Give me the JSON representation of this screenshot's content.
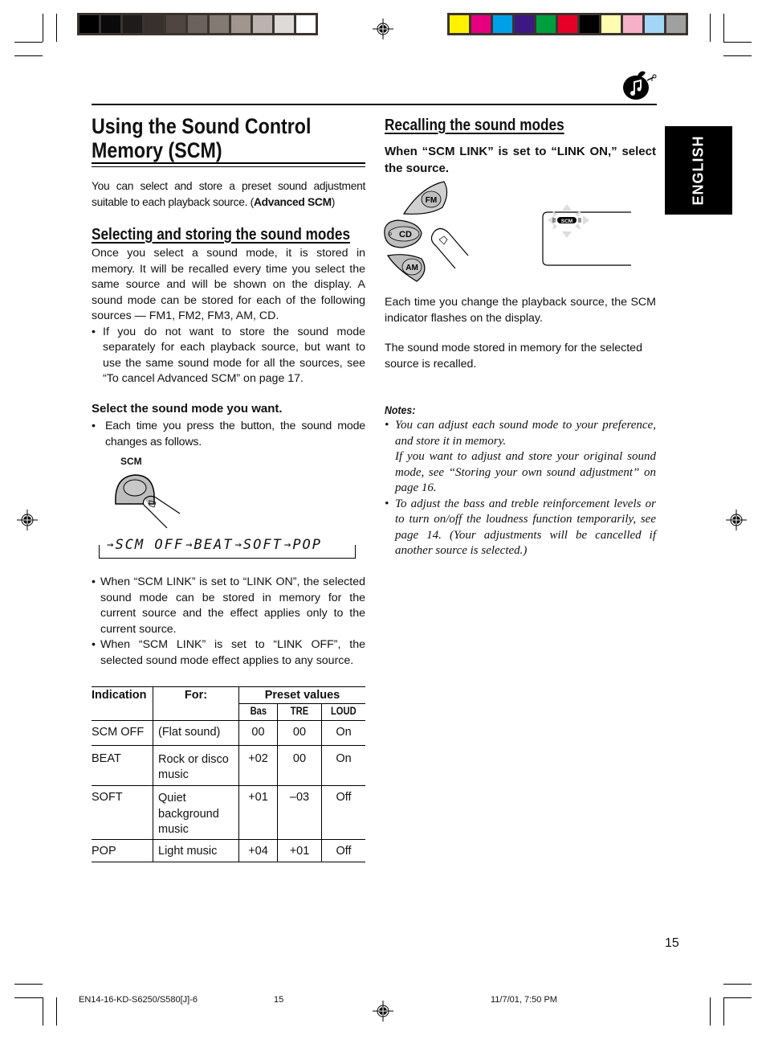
{
  "print_marks": {
    "grayscale_bar": [
      "#000000",
      "#0a0a0a",
      "#1e1b1a",
      "#38302d",
      "#4f4641",
      "#6b625d",
      "#847a74",
      "#a0958f",
      "#bcb2ae",
      "#dedad8",
      "#ffffff"
    ],
    "color_bar": [
      "#fff200",
      "#e6007e",
      "#00a0e9",
      "#3c1882",
      "#009e3f",
      "#e60027",
      "#000000",
      "#fffbb0",
      "#f6b0c8",
      "#a3d6f5",
      "#a0a0a0"
    ]
  },
  "sidebar": {
    "language_tab": "ENGLISH"
  },
  "header": {
    "icon": "music-note-bag-icon"
  },
  "left": {
    "title_line1": "Using the Sound Control",
    "title_line2": "Memory (SCM)",
    "intro_text": "You can select and store a preset sound adjustment suitable to each playback source. (",
    "intro_bold": "Advanced SCM",
    "intro_end": ")",
    "section_heading": "Selecting and storing the sound modes",
    "section_body": "Once you select a sound mode, it is stored in memory. It will be recalled every time you select the same source and will be shown on the display. A sound mode can be stored for each of the following sources — FM1, FM2, FM3, AM, CD.",
    "section_bullet": "If you do not want to store the sound mode separately for each playback source, but want to use the same sound mode for all the sources, see “To cancel Advanced SCM” on page 17.",
    "step_heading": "Select the sound mode you want.",
    "step_bullet": "Each time you press the button, the sound mode changes as follows.",
    "scm_button_label": "SCM",
    "mode_sequence": [
      "SCM OFF",
      "BEAT",
      "SOFT",
      "POP"
    ],
    "link_bullets": [
      "When “SCM LINK” is set to “LINK ON”, the selected sound mode can be stored in memory for the current source and the effect applies only to the current source.",
      "When “SCM LINK” is set to “LINK OFF”, the selected sound mode effect applies to any source."
    ]
  },
  "table": {
    "headers": {
      "indication": "Indication",
      "for": "For:",
      "preset": "Preset values",
      "bas": "Bas",
      "tre": "TRE",
      "loud": "LOUD"
    },
    "rows": [
      {
        "indication": "SCM OFF",
        "for": "(Flat sound)",
        "bas": "00",
        "tre": "00",
        "loud": "On"
      },
      {
        "indication": "BEAT",
        "for": "Rock or disco music",
        "bas": "+02",
        "tre": "00",
        "loud": "On"
      },
      {
        "indication": "SOFT",
        "for": "Quiet background music",
        "bas": "+01",
        "tre": "–03",
        "loud": "Off"
      },
      {
        "indication": "POP",
        "for": "Light music",
        "bas": "+04",
        "tre": "+01",
        "loud": "Off"
      }
    ]
  },
  "right": {
    "section_heading": "Recalling the sound modes",
    "step_heading": "When “SCM LINK” is set to “LINK ON,” select the source.",
    "source_buttons": [
      "FM",
      "CD",
      "AM"
    ],
    "display_indicator": "SCM",
    "body1": "Each time you change the playback source, the SCM indicator flashes on the display.",
    "body2": "The sound mode stored in memory for the selected source is recalled.",
    "notes_heading": "Notes:",
    "note1_a": "You can adjust each sound mode to your preference, and store it in memory.",
    "note1_b": "If you want to adjust and store your original sound mode, see “Storing your own sound adjustment” on page 16.",
    "note2": "To adjust the bass and treble reinforcement levels or to turn on/off the loudness function temporarily, see page 14. (Your adjustments will be cancelled if another source is selected.)"
  },
  "page_number": "15",
  "footer": {
    "file": "EN14-16-KD-S6250/S580[J]-6",
    "page": "15",
    "timestamp": "11/7/01, 7:50 PM"
  }
}
